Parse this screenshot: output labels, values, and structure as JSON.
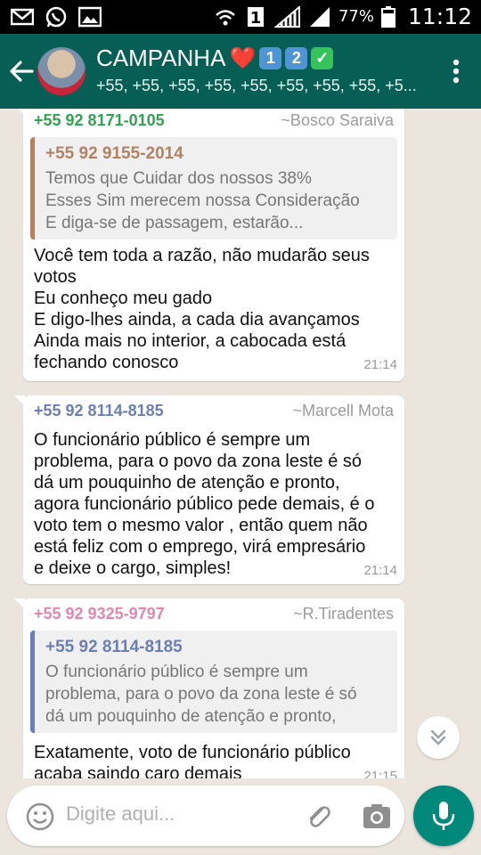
{
  "statusbar": {
    "battery": "77%",
    "time": "11:12",
    "left_icons": [
      "mail-icon",
      "whatsapp-icon",
      "image-icon"
    ],
    "right_icons": [
      "wifi-icon",
      "sim1-icon",
      "signal-icon",
      "signal-2-icon",
      "battery-icon"
    ]
  },
  "header": {
    "title": "CAMPANHA",
    "emoji_heart": "❤️",
    "badge_1": "1",
    "badge_2": "2",
    "badge_check": "✓",
    "subtitle": "+55, +55, +55, +55, +55, +55, +55, +55, +5...",
    "accent_color": "#075e54"
  },
  "messages": [
    {
      "sender_number": "+55 92 8171-0105",
      "sender_color": "#2ea44f",
      "sender_name": "~Bosco Saraiva",
      "quote": {
        "number": "+55 92 9155-2014",
        "color": "#b38262",
        "text_lines": [
          "Temos que Cuidar dos nossos 38%",
          "Esses Sim merecem nossa Consideração",
          "E diga-se de passagem,  estarão..."
        ]
      },
      "text_lines": [
        "Você tem toda a razão,  não mudarão seus",
        "votos",
        "Eu conheço meu gado",
        "E digo-lhes ainda,  a cada dia avançamos",
        "Ainda mais  no interior,  a cabocada está",
        "fechando conosco"
      ],
      "time": "21:14"
    },
    {
      "sender_number": "+55 92 8114-8185",
      "sender_color": "#6a7fb5",
      "sender_name": "~Marcell Mota",
      "text_lines": [
        "O funcionário público é sempre um",
        "problema, para o povo da zona leste é só",
        "dá um pouquinho de atenção e pronto,",
        "agora funcionário público pede demais, é o",
        "voto tem o mesmo valor , então quem não",
        "está feliz com o emprego, virá empresário",
        "e deixe o cargo, simples!"
      ],
      "time": "21:14"
    },
    {
      "sender_number": "+55 92 9325-9797",
      "sender_color": "#e585b0",
      "sender_name": "~R.Tiradentes",
      "quote": {
        "number": "+55 92 8114-8185",
        "color": "#6a7fb5",
        "text_lines": [
          "O funcionário público é sempre um",
          "problema, para o povo da zona leste é só",
          "dá um pouquinho de atenção e pronto,"
        ]
      },
      "text_lines": [
        "Exatamente, voto de funcionário público",
        "acaba saindo caro demais"
      ],
      "time": "21:15"
    }
  ],
  "composer": {
    "placeholder": "Digite aqui...",
    "icons": [
      "emoji-icon",
      "attach-icon",
      "camera-icon",
      "mic-icon"
    ]
  }
}
